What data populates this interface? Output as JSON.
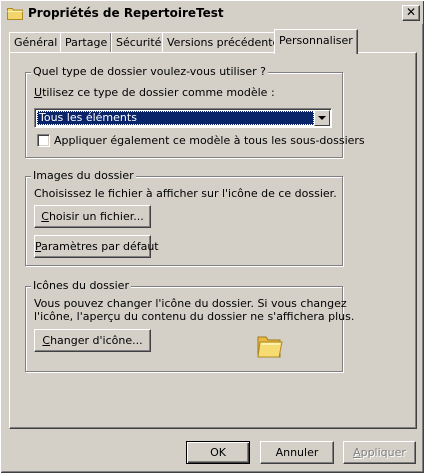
{
  "window": {
    "title": "Propriétés de RepertoireTest",
    "close_glyph": "✕",
    "title_icon": "folder-icon"
  },
  "tabs": [
    {
      "label": "Général",
      "active": false
    },
    {
      "label": "Partage",
      "active": false
    },
    {
      "label": "Sécurité",
      "active": false
    },
    {
      "label": "Versions précédentes",
      "active": false
    },
    {
      "label": "Personnaliser",
      "active": true
    }
  ],
  "folder_type": {
    "legend": "Quel type de dossier voulez-vous utiliser ?",
    "template_label_u": "U",
    "template_label_rest": "tilisez ce type de dossier comme modèle :",
    "selected_template": "Tous les éléments",
    "apply_subfolders_label": "Appliquer également ce modèle à tous les sous-dossiers",
    "apply_subfolders_checked": false
  },
  "folder_pictures": {
    "legend": "Images du dossier",
    "description": "Choisissez le fichier à afficher sur l'icône de ce dossier.",
    "choose_file_u": "C",
    "choose_file_rest": "hoisir un fichier...",
    "restore_default_u": "P",
    "restore_default_rest": "aramètres par défaut"
  },
  "folder_icons": {
    "legend": "Icônes du dossier",
    "description_line1": "Vous pouvez changer l'icône du dossier. Si vous changez",
    "description_line2": "l'icône, l'aperçu du contenu du dossier ne s'affichera plus.",
    "change_icon_u": "C",
    "change_icon_rest": "hanger d'icône...",
    "preview_icon": "folder-icon"
  },
  "buttons": {
    "ok": "OK",
    "cancel": "Annuler",
    "apply_u": "A",
    "apply_rest": "ppliquer",
    "apply_disabled": true
  },
  "colors": {
    "face": "#d4d0c8",
    "selection": "#0a246a",
    "folder": "#f3d66b"
  }
}
